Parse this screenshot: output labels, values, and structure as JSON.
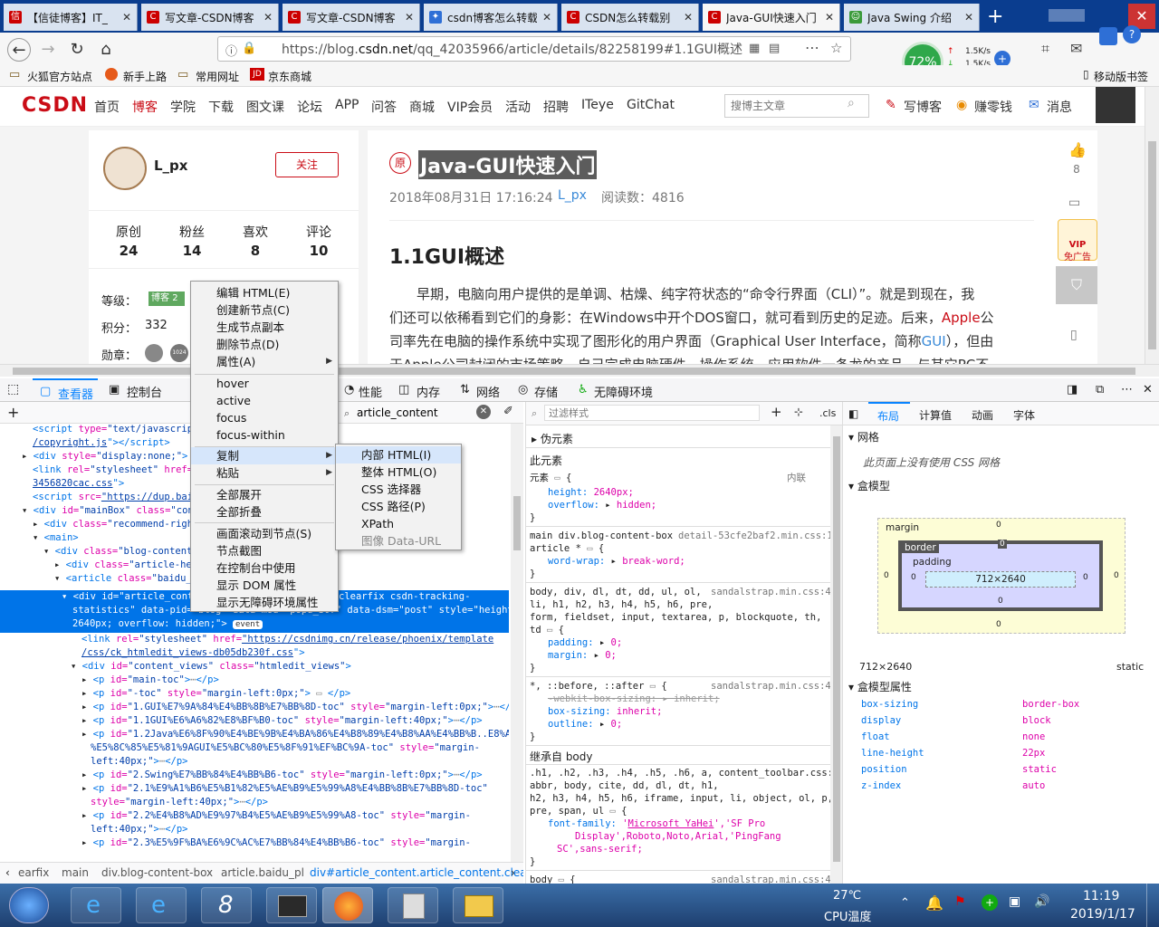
{
  "browser": {
    "tabs": [
      {
        "title": "【信徒博客】IT_",
        "icon": "red-square-icon"
      },
      {
        "title": "写文章-CSDN博客",
        "icon": "csdn-icon"
      },
      {
        "title": "写文章-CSDN博客",
        "icon": "csdn-icon"
      },
      {
        "title": "csdn博客怎么转载",
        "icon": "paw-icon"
      },
      {
        "title": "CSDN怎么转载别",
        "icon": "csdn-icon"
      },
      {
        "title": "Java-GUI快速入门",
        "icon": "csdn-icon"
      },
      {
        "title": "Java Swing 介绍",
        "icon": "green-icon"
      }
    ],
    "url_prefix": "https://blog.",
    "url_domain": "csdn.net",
    "url_path": "/qq_42035966/article/details/82258199#1.1GUI概述",
    "perf": {
      "cpu": "72%",
      "up": "1.5K/s",
      "down": "1.5K/s"
    },
    "bookmarks": [
      "火狐官方站点",
      "新手上路",
      "常用网址",
      "京东商城"
    ],
    "mobile_bookmarks": "移动版书签"
  },
  "csdn": {
    "logo": "CSDN",
    "nav": [
      "首页",
      "博客",
      "学院",
      "下载",
      "图文课",
      "论坛",
      "APP",
      "问答",
      "商城",
      "VIP会员",
      "活动",
      "招聘",
      "ITeye",
      "GitChat"
    ],
    "search_placeholder": "搜博主文章",
    "write": "写博客",
    "earn": "赚零钱",
    "msg": "消息",
    "close": "关闭"
  },
  "profile": {
    "name": "L_px",
    "follow": "关注",
    "stats": [
      {
        "label": "原创",
        "value": "24"
      },
      {
        "label": "粉丝",
        "value": "14"
      },
      {
        "label": "喜欢",
        "value": "8"
      },
      {
        "label": "评论",
        "value": "10"
      }
    ],
    "level_label": "等级：",
    "level_badge": "博客",
    "level_num": "2",
    "points_label": "积分：",
    "points": "332",
    "medal_label": "勋章：",
    "medal_num": "1024"
  },
  "article": {
    "orig_badge": "原",
    "title": "Java-GUI快速入门",
    "date": "2018年08月31日 17:16:24",
    "author": "L_px",
    "reads": "阅读数：4816",
    "h1": "1.1GUI概述",
    "p1a": "早期，电脑向用户提供的是单调、枯燥、纯字符状态的“命令行界面（CLI）”。就是到现在，我",
    "p1b": "们还可以依稀看到它们的身影：在Windows中开个DOS窗口，就可看到历史的足迹。后来，",
    "apple": "Apple",
    "p1c": "公",
    "p2a": "司率先在电脑的操作系统中实现了图形化的用户界面（Graphical User Interface，简称",
    "gui": "GUI",
    "p2b": "），但由",
    "p3": "于Apple公司封闭的市场策略，自己完成电脑硬件、操作系统、应用软件一条龙的产品，与其它PC不",
    "likes": "8",
    "vip": "VIP",
    "vip_sub": "免广告"
  },
  "devtools": {
    "tabs": [
      "查看器",
      "控制台",
      "性能",
      "内存",
      "网络",
      "存储",
      "无障碍环境"
    ],
    "search_value": "article_content",
    "filter_placeholder": "过滤样式",
    "cls": ".cls",
    "layout_tabs": [
      "布局",
      "计算值",
      "动画",
      "字体"
    ],
    "grid_title": "网格",
    "grid_msg": "此页面上没有使用 CSS 网格",
    "box_title": "盒模型",
    "box": {
      "margin": "margin",
      "border": "border",
      "padding": "padding",
      "content": "712×2640",
      "zero": "0"
    },
    "box_size": "712×2640",
    "box_pos": "static",
    "box_props_title": "盒模型属性",
    "box_props": [
      {
        "name": "box-sizing",
        "value": "border-box"
      },
      {
        "name": "display",
        "value": "block"
      },
      {
        "name": "float",
        "value": "none"
      },
      {
        "name": "line-height",
        "value": "22px"
      },
      {
        "name": "position",
        "value": "static"
      },
      {
        "name": "z-index",
        "value": "auto"
      }
    ],
    "pseudo": "伪元素",
    "this_elem": "此元素",
    "elem_label": "元素",
    "inline": "内联",
    "inherit_label": "继承自 body",
    "breadcrumbs": [
      "earfix",
      "main",
      "div.blog-content-box",
      "article.baidu_pl",
      "div#article_content.article_content.clea…"
    ]
  },
  "context_menu": {
    "items": [
      "编辑 HTML(E)",
      "创建新节点(C)",
      "生成节点副本",
      "删除节点(D)",
      "属性(A)",
      "hover",
      "active",
      "focus",
      "focus-within",
      "复制",
      "粘贴",
      "全部展开",
      "全部折叠",
      "画面滚动到节点(S)",
      "节点截图",
      "在控制台中使用",
      "显示 DOM 属性",
      "显示无障碍环境属性"
    ],
    "submenu": [
      "内部 HTML(I)",
      "整体 HTML(O)",
      "CSS 选择器",
      "CSS 路径(P)",
      "XPath",
      "图像 Data-URL"
    ]
  },
  "taskbar": {
    "temp": "27℃",
    "temp_label": "CPU温度",
    "time": "11:19",
    "date": "2019/1/17"
  }
}
